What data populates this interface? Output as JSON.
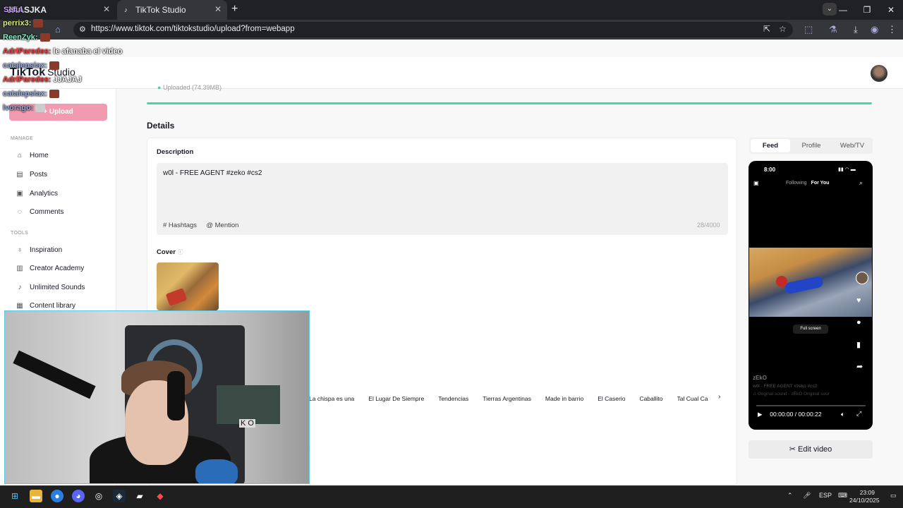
{
  "browser": {
    "tabs": [
      {
        "label": "JKASJKA"
      },
      {
        "label": "TikTok Studio"
      }
    ],
    "url": "https://www.tiktok.com/tiktokstudio/upload?from=webapp"
  },
  "header": {
    "logo": "TikTok",
    "logo_suffix": "Studio"
  },
  "sidebar": {
    "upload_label": "+ Upload",
    "manage_label": "MANAGE",
    "tools_label": "TOOLS",
    "manage_items": [
      {
        "label": "Home",
        "icon": "home-icon"
      },
      {
        "label": "Posts",
        "icon": "posts-icon"
      },
      {
        "label": "Analytics",
        "icon": "analytics-icon"
      },
      {
        "label": "Comments",
        "icon": "comments-icon"
      }
    ],
    "tool_items": [
      {
        "label": "Inspiration",
        "icon": "lightbulb-icon"
      },
      {
        "label": "Creator Academy",
        "icon": "academy-icon"
      },
      {
        "label": "Unlimited Sounds",
        "icon": "music-note-icon"
      },
      {
        "label": "Content library",
        "icon": "library-icon"
      }
    ]
  },
  "main": {
    "uploaded_text": "Uploaded (74.39MB)",
    "details_title": "Details",
    "description_label": "Description",
    "description_value": "w0l - FREE AGENT #zeko #cs2",
    "hashtags_label": "# Hashtags",
    "mention_label": "@ Mention",
    "char_count": "28/4000",
    "cover_label": "Cover",
    "tags": [
      "La chispa es una",
      "El Lugar De Siempre",
      "Tendencias",
      "Tierras Argentinas",
      "Made in barrio",
      "El Caserio",
      "Caballito",
      "Tal Cual Ca"
    ]
  },
  "preview": {
    "segments": [
      "Feed",
      "Profile",
      "Web/TV"
    ],
    "active_segment": "Feed",
    "phone_time": "8:00",
    "following": "Following",
    "for_you": "For You",
    "full_screen": "Full screen",
    "username": "zEkO",
    "caption": "w0l - FREE AGENT #zeko #cs2",
    "sound": "♫ Original sound - zEkO   Original sour",
    "time_display": "00:00:00 / 00:00:22",
    "edit_video": "Edit video"
  },
  "chat": [
    {
      "user": "perrix3:",
      "text": "",
      "color": "#d8f07a"
    },
    {
      "user": "ReenZyk:",
      "text": "",
      "color": "#7ef0c8"
    },
    {
      "user": "AdriParedes:",
      "text": "le afanaba el video",
      "color": "#ff3b3b"
    },
    {
      "user": "AdriParedes:",
      "text": "JJAJAJ",
      "color": "#ff3b3b"
    },
    {
      "user": "catalepsiax:",
      "text": "",
      "color": "#9ad"
    },
    {
      "user": "catalepsiax:",
      "text": "",
      "color": "#9ad"
    },
    {
      "user": "lvorago:",
      "text": "",
      "color": "#9ad"
    }
  ],
  "taskbar": {
    "lang": "ESP",
    "time": "23:09",
    "date": "24/10/2025"
  },
  "colors": {
    "accent_pink": "#fe2c55",
    "progress_green": "#3fd8a9"
  }
}
